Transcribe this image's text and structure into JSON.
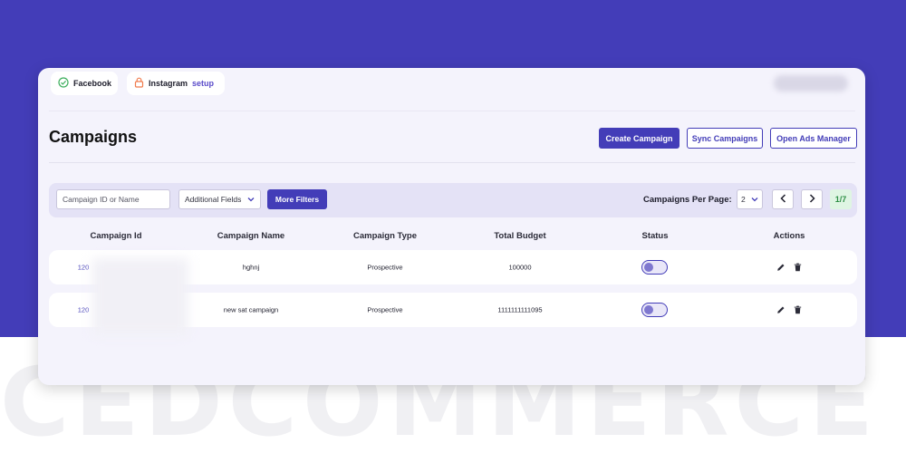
{
  "tabs": [
    {
      "label": "Facebook",
      "icon": "check-circle-icon"
    },
    {
      "label": "Instagram",
      "icon": "lock-icon",
      "setup_label": "setup"
    }
  ],
  "page": {
    "title": "Campaigns"
  },
  "actions": {
    "create": "Create Campaign",
    "sync": "Sync Campaigns",
    "open_ads_manager": "Open Ads Manager"
  },
  "filters": {
    "search_placeholder": "Campaign ID or Name",
    "additional_fields": "Additional Fields",
    "more_filters": "More Filters",
    "per_page_label": "Campaigns Per Page:",
    "per_page_value": "2",
    "page_indicator": "1/7"
  },
  "table": {
    "headers": [
      "Campaign Id",
      "Campaign Name",
      "Campaign Type",
      "Total Budget",
      "Status",
      "Actions"
    ],
    "rows": [
      {
        "id": "120",
        "name": "hghnj",
        "type": "Prospective",
        "budget": "100000",
        "status_on": false
      },
      {
        "id": "120",
        "name": "new sat campaign",
        "type": "Prospective",
        "budget": "1111111111095",
        "status_on": false
      }
    ]
  },
  "watermark": "CEDCOMMERCE",
  "colors": {
    "brand": "#433db8",
    "background": "#433db8",
    "card": "#f4f3fc",
    "success": "#2f8f46"
  }
}
